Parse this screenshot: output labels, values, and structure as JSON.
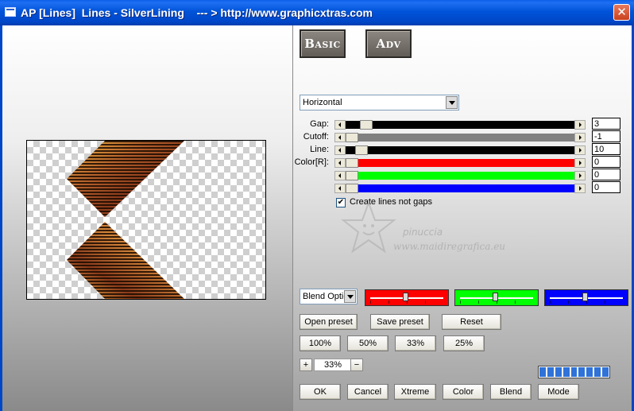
{
  "window": {
    "title": "AP [Lines]  Lines - SilverLining    --- > http://www.graphicxtras.com",
    "close_glyph": "✕"
  },
  "tabs": {
    "basic": "Basic",
    "adv": "Adv"
  },
  "direction": {
    "selected": "Horizontal"
  },
  "params": {
    "gap": {
      "label": "Gap:",
      "value": "3"
    },
    "cutoff": {
      "label": "Cutoff:",
      "value": "-1"
    },
    "line": {
      "label": "Line:",
      "value": "10"
    },
    "color_r": {
      "label": "Color[R]:",
      "value": "0"
    },
    "color_g": {
      "value": "0"
    },
    "color_b": {
      "value": "0"
    }
  },
  "checkbox": {
    "label": "Create lines not gaps",
    "checked": true,
    "mark": "✔"
  },
  "watermark": {
    "line1": "pinuccia",
    "line2": "www.maidiregrafica.eu"
  },
  "blend": {
    "selected": "Blend Optio",
    "colors": {
      "red": "#ff0000",
      "green": "#00ff00",
      "blue": "#0000ff"
    }
  },
  "preset_buttons": {
    "open": "Open preset",
    "save": "Save preset",
    "reset": "Reset"
  },
  "zoom_buttons": [
    "100%",
    "50%",
    "33%",
    "25%"
  ],
  "zoom": {
    "plus": "+",
    "value": "33%",
    "minus": "−"
  },
  "progress": {
    "segments": 9
  },
  "bottom_buttons": {
    "ok": "OK",
    "cancel": "Cancel",
    "xtreme": "Xtreme",
    "color": "Color",
    "blend": "Blend",
    "mode": "Mode"
  },
  "colors": {
    "title_bar": "#0046c8",
    "red": "#ff0000",
    "green": "#00ff00",
    "blue": "#0000ff",
    "gray_track": "#808080"
  }
}
